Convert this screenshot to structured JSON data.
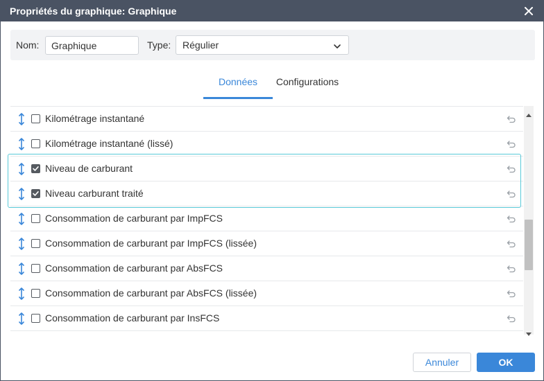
{
  "dialog": {
    "title": "Propriétés du graphique: Graphique",
    "close_icon": "close-icon"
  },
  "form": {
    "name_label": "Nom:",
    "name_value": "Graphique",
    "type_label": "Type:",
    "type_value": "Régulier"
  },
  "tabs": [
    {
      "label": "Données",
      "active": true
    },
    {
      "label": "Configurations",
      "active": false
    }
  ],
  "sensors": [
    {
      "label": "Kilométrage instantané",
      "checked": false
    },
    {
      "label": "Kilométrage instantané (lissé)",
      "checked": false
    },
    {
      "label": "Niveau de carburant",
      "checked": true
    },
    {
      "label": "Niveau carburant traité",
      "checked": true
    },
    {
      "label": "Consommation de carburant par ImpFCS",
      "checked": false
    },
    {
      "label": "Consommation de carburant par ImpFCS (lissée)",
      "checked": false
    },
    {
      "label": "Consommation de carburant par AbsFCS",
      "checked": false
    },
    {
      "label": "Consommation de carburant par AbsFCS (lissée)",
      "checked": false
    },
    {
      "label": "Consommation de carburant par InsFCS",
      "checked": false
    }
  ],
  "buttons": {
    "cancel": "Annuler",
    "ok": "OK"
  },
  "colors": {
    "titlebar": "#4a5363",
    "accent": "#3a87d9",
    "highlight": "#59c9d8"
  }
}
